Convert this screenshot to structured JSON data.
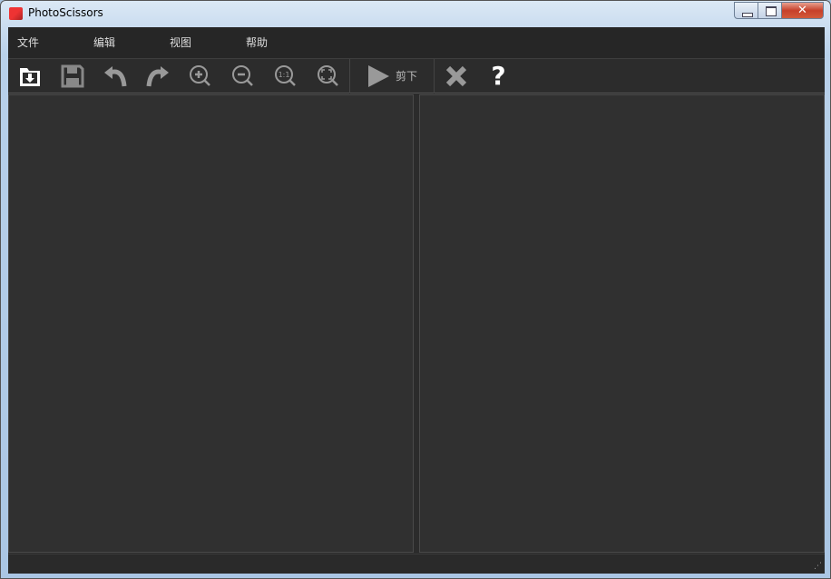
{
  "window": {
    "title": "PhotoScissors"
  },
  "menu": [
    "文件",
    "编辑",
    "视图",
    "帮助"
  ],
  "toolbar": {
    "cut_label": "剪下",
    "help_label": "?"
  }
}
